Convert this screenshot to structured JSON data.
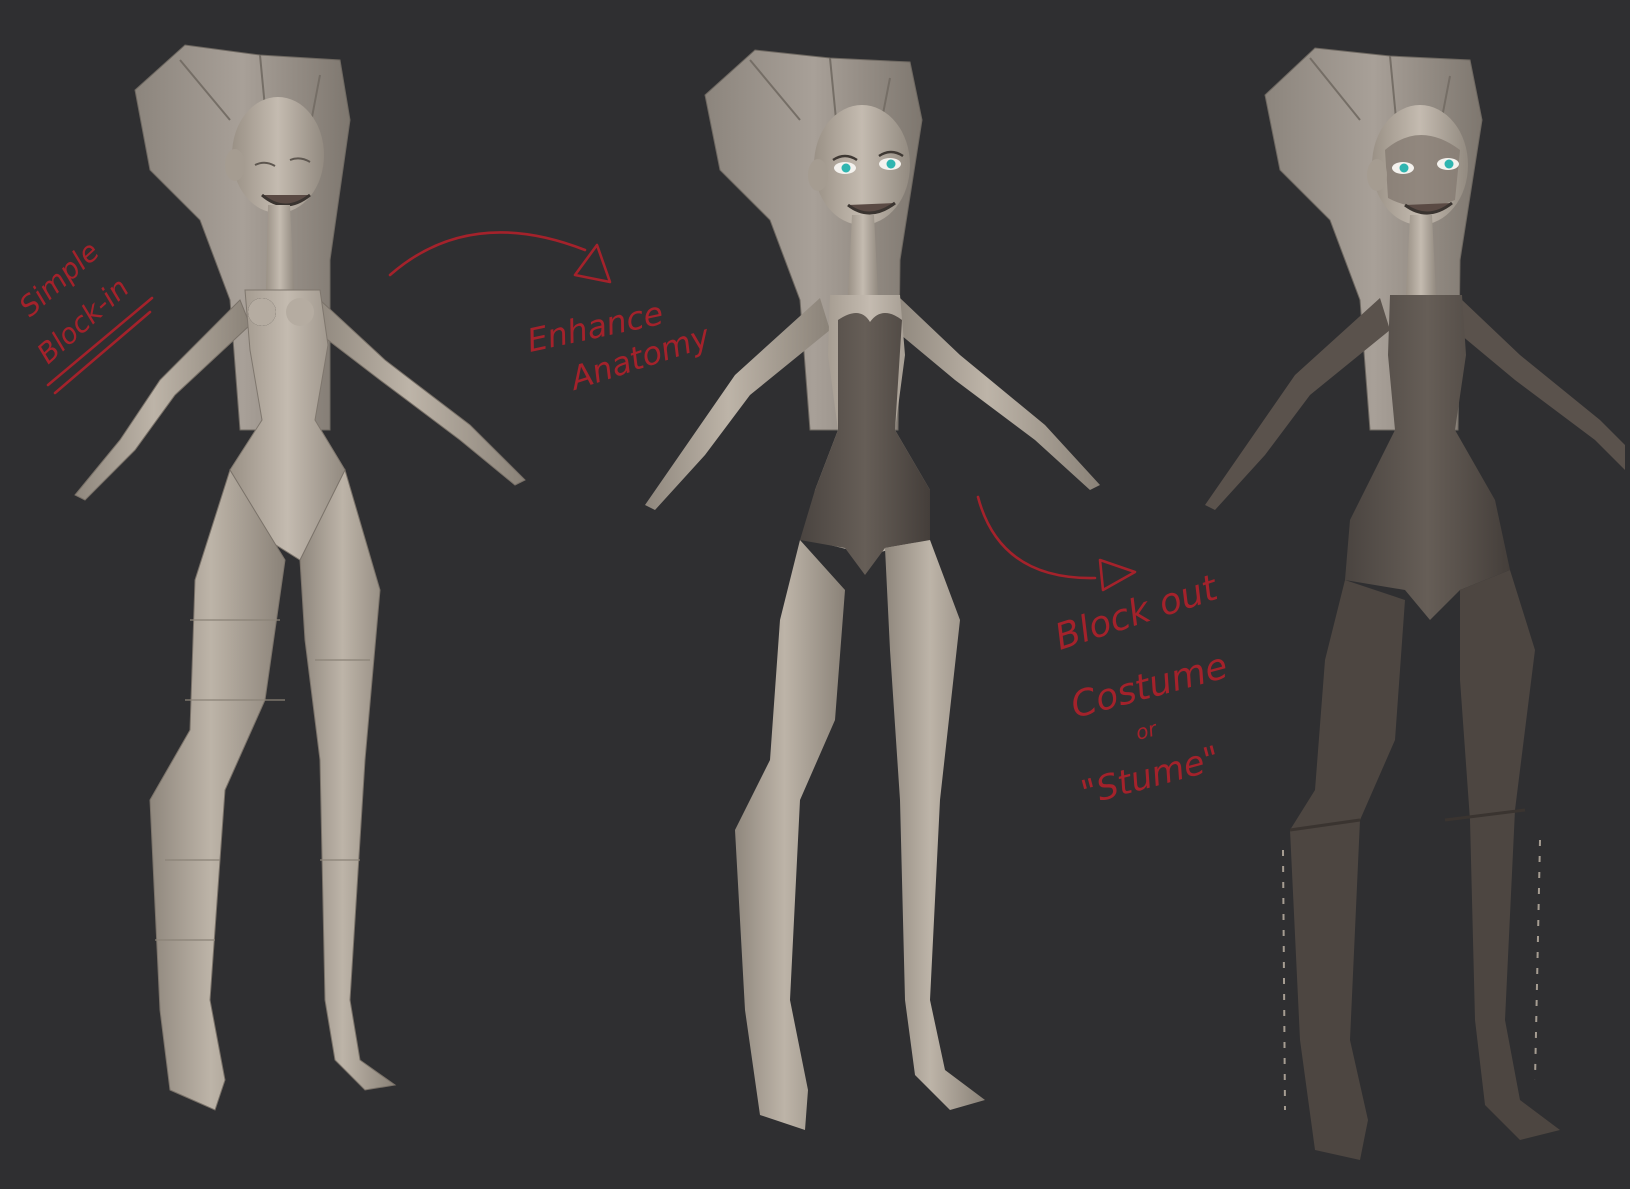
{
  "annotations": {
    "stage1_line1": "Simple",
    "stage1_line2": "Block-in",
    "stage2_line1": "Enhance",
    "stage2_line2": "Anatomy",
    "stage3_line1": "Block out",
    "stage3_line2": "Costume",
    "stage3_line3": "or",
    "stage3_line4": "\"Stume\""
  },
  "colors": {
    "background": "#2f2f31",
    "clay_light": "#b3aa9f",
    "clay_dark": "#57504a",
    "annotation_red": "#a4222b",
    "eye_teal": "#2fb5b0"
  }
}
